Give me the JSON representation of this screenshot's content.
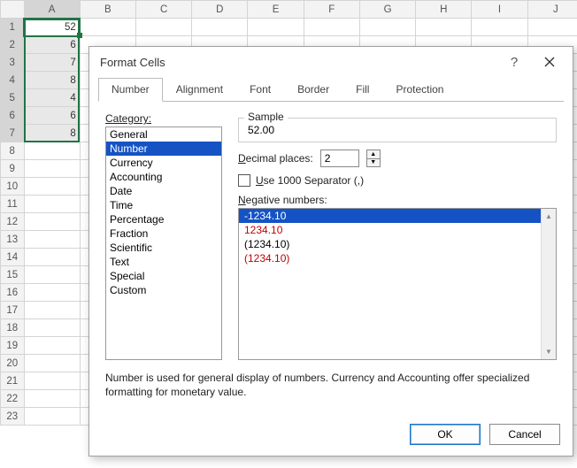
{
  "columns": [
    "A",
    "B",
    "C",
    "D",
    "E",
    "F",
    "G",
    "H",
    "I",
    "J"
  ],
  "rows": [
    1,
    2,
    3,
    4,
    5,
    6,
    7,
    8,
    9,
    10,
    11,
    12,
    13,
    14,
    15,
    16,
    17,
    18,
    19,
    20,
    21,
    22,
    23
  ],
  "cells": {
    "A1": "52",
    "A2": "6",
    "A3": "7",
    "A4": "8",
    "A5": "4",
    "A6": "6",
    "A7": "8"
  },
  "selected_range_rows": [
    1,
    2,
    3,
    4,
    5,
    6,
    7
  ],
  "dialog": {
    "title": "Format Cells",
    "tabs": [
      "Number",
      "Alignment",
      "Font",
      "Border",
      "Fill",
      "Protection"
    ],
    "active_tab": 0,
    "category_label": "Category:",
    "categories": [
      "General",
      "Number",
      "Currency",
      "Accounting",
      "Date",
      "Time",
      "Percentage",
      "Fraction",
      "Scientific",
      "Text",
      "Special",
      "Custom"
    ],
    "selected_category_index": 1,
    "sample_label": "Sample",
    "sample_value": "52.00",
    "decimal_label_pre": "D",
    "decimal_label_post": "ecimal places:",
    "decimal_value": "2",
    "separator_label_pre": "U",
    "separator_label_post": "se 1000 Separator (,)",
    "negative_label_pre": "N",
    "negative_label_post": "egative numbers:",
    "negative_formats": [
      {
        "text": "-1234.10",
        "red": false
      },
      {
        "text": "1234.10",
        "red": true
      },
      {
        "text": "(1234.10)",
        "red": false
      },
      {
        "text": "(1234.10)",
        "red": true
      }
    ],
    "selected_negative_index": 0,
    "description": "Number is used for general display of numbers.  Currency and Accounting offer specialized formatting for monetary value.",
    "ok_label": "OK",
    "cancel_label": "Cancel"
  }
}
